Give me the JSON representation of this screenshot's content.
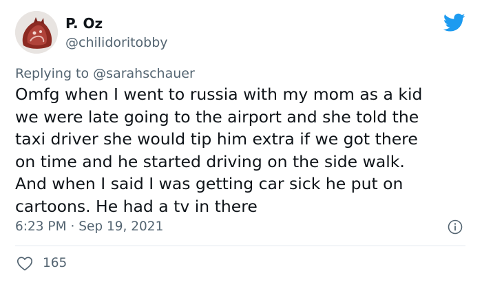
{
  "author": {
    "name": "P. Oz",
    "handle": "@chilidoritobby"
  },
  "reply_context": {
    "prefix": "Replying to",
    "mention": "@sarahschauer"
  },
  "tweet": {
    "lines": [
      "Omfg when I went to russia with my mom as a kid",
      "we were late going to the airport and she told the",
      "taxi driver she would tip him extra if we got there",
      "on time and he started driving on the side walk.",
      "And when I said I was getting car sick he put on",
      "cartoons. He had a tv in there"
    ],
    "time": "6:23 PM",
    "separator": "·",
    "date": "Sep 19, 2021"
  },
  "stats": {
    "likes": "165"
  },
  "icons": {
    "brand": "twitter-bird-icon",
    "info": "info-icon",
    "like": "heart-icon"
  },
  "colors": {
    "brand": "#1d9bf0",
    "text": "#0f1419",
    "secondary": "#536471",
    "divider": "#e1e8ed"
  }
}
